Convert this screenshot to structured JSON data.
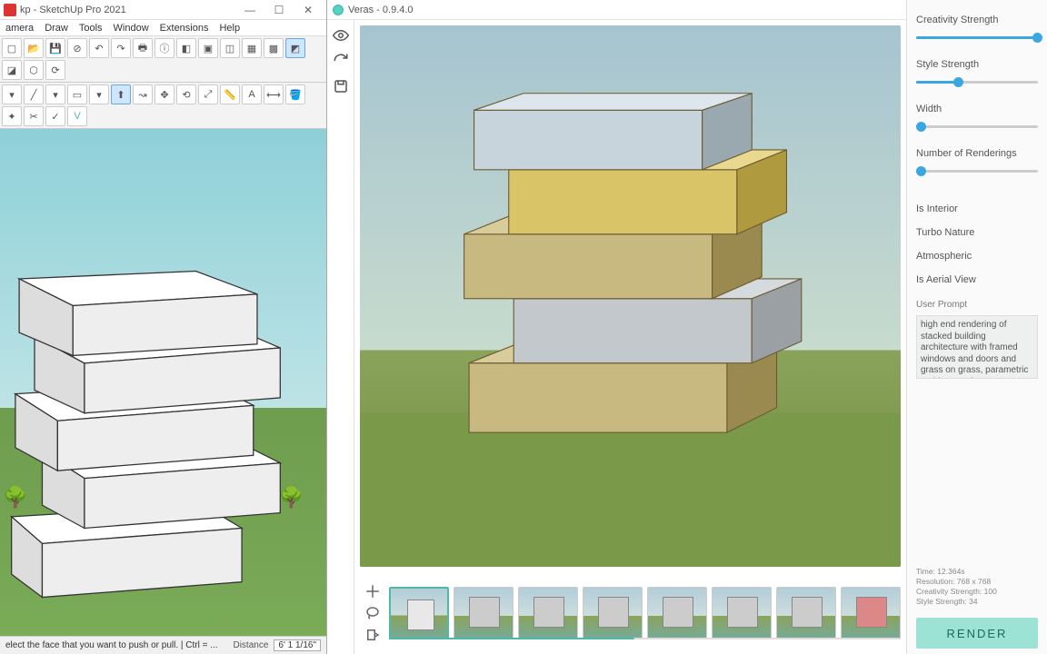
{
  "sketchup": {
    "title": "kp - SketchUp Pro 2021",
    "menu": [
      "amera",
      "Draw",
      "Tools",
      "Window",
      "Extensions",
      "Help"
    ],
    "status_hint": "elect the face that you want to push or pull. | Ctrl = ...",
    "distance_label": "Distance",
    "distance_value": "6' 1 1/16\""
  },
  "veras": {
    "title": "Veras - 0.9.4.0",
    "sliders": {
      "creativity": {
        "label": "Creativity Strength",
        "pct": 100
      },
      "style": {
        "label": "Style Strength",
        "pct": 35
      },
      "width": {
        "label": "Width",
        "pct": 2
      },
      "renderings": {
        "label": "Number of Renderings",
        "pct": 2
      }
    },
    "checks": [
      "Is Interior",
      "Turbo Nature",
      "Atmospheric",
      "Is Aerial View"
    ],
    "prompt_label": "User Prompt",
    "prompt": "high end rendering of stacked building architecture with framed windows and doors and grass on grass, parametric architecture hour, corrugated steel, city ((((big colorful graffiti art))))",
    "stats": {
      "time": "Time: 12.364s",
      "res": "Resolution: 768 x 768",
      "cs": "Creativity Strength: 100",
      "ss": "Style Strength: 34"
    },
    "render_label": "RENDER"
  }
}
